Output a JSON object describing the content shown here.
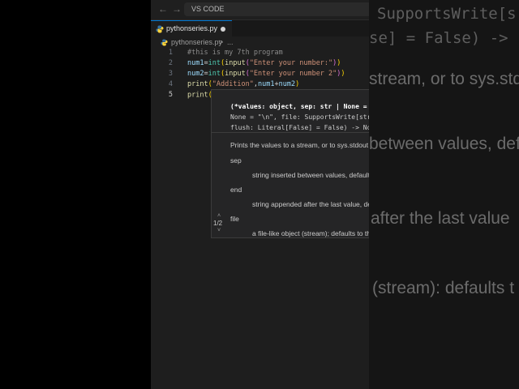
{
  "window": {
    "search_label": "VS CODE",
    "back_arrow": "←",
    "forward_arrow": "→"
  },
  "tab": {
    "filename": "pythonseries.py",
    "icon": "python-file-icon",
    "modified": true
  },
  "breadcrumb": {
    "file": "pythonseries.py",
    "separator": ">",
    "more": "..."
  },
  "editor": {
    "lines": [
      {
        "number": "1",
        "text": "#this is my 7th program"
      },
      {
        "number": "2",
        "text": "num1=int(input(\"Enter your number:\"))"
      },
      {
        "number": "3",
        "text": "num2=int(input(\"Enter your number 2\"))"
      },
      {
        "number": "4",
        "text": "print(\"Addition\",num1+num2)"
      },
      {
        "number": "5",
        "text": "print()"
      }
    ]
  },
  "popup": {
    "signature_1": "(*values: object, sep: str | None = \" \", end: str |",
    "signature_2": "None = \"\\n\", file: SupportsWrite[str] | None = None,",
    "signature_3": "flush: Literal[False] = False) -> None",
    "description": "Prints the values to a stream, or to sys.stdout by default.",
    "param_sep": "sep",
    "param_sep_desc": "string inserted between values, default a space.",
    "param_end": "end",
    "param_end_desc": "string appended after the last value, default a newline.",
    "param_file": "file",
    "param_file_desc": "a file-like object (stream); defaults to the current sys.stdout.",
    "overload_count": "1/2",
    "overload_up": "˄",
    "overload_down": "˅"
  },
  "background": {
    "line_1": "SupportsWrite[s",
    "line_2": "se] = False) ->",
    "line_3": "stream, or to sys.std",
    "line_4": "between values, defa",
    "line_5": "after the last value",
    "line_6": "(stream): defaults t"
  },
  "colors": {
    "editor_bg": "#1e1e1e",
    "accent": "#0078d4",
    "python_blue": "#3572a5",
    "python_yellow": "#ffd43b"
  }
}
